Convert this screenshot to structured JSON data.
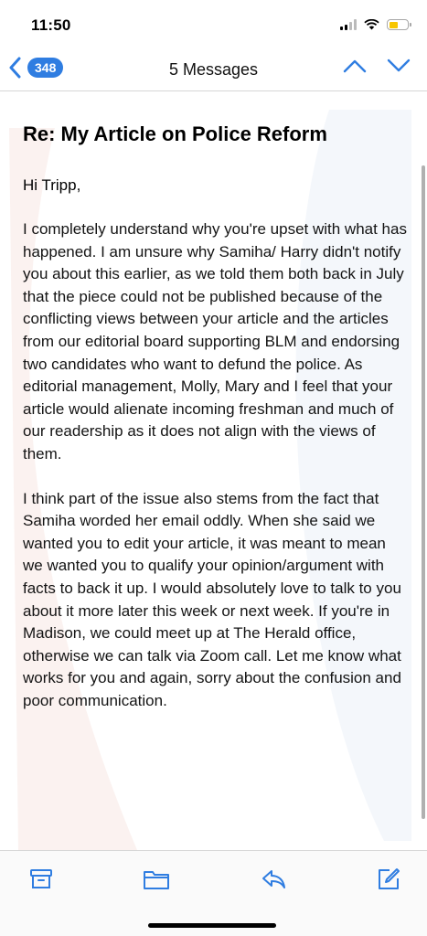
{
  "status": {
    "time": "11:50"
  },
  "nav": {
    "unread_count": "348",
    "title": "5 Messages"
  },
  "email": {
    "subject": "Re:  My Article on Police Reform",
    "greeting": "Hi Tripp,",
    "paragraphs": [
      "I completely understand why you're upset with what has happened. I am unsure why Samiha/ Harry didn't notify you about this earlier, as we told them both back in July that the piece could not be published because of the conflicting views between your article and the articles from our editorial board supporting BLM and endorsing two candidates who want to defund the police. As editorial management, Molly, Mary and I feel that your article would alienate incoming freshman and much of our readership as it does not align with the views of them.",
      "I think part of the issue also stems from the fact that Samiha worded her email oddly. When she said we wanted you to edit your article, it was meant to mean we wanted you to qualify your opinion/argument with facts to back it up. I would absolutely love to talk to you about it more later this week or next week. If you're in Madison, we could meet up at The Herald office, otherwise we can talk via Zoom call. Let me know what works for you and again, sorry about the confusion and poor communication."
    ]
  },
  "colors": {
    "accent": "#2f7de1",
    "battery": "#f7c600"
  },
  "toolbar": {
    "icons": [
      "archive-icon",
      "folder-icon",
      "reply-icon",
      "compose-icon"
    ]
  }
}
